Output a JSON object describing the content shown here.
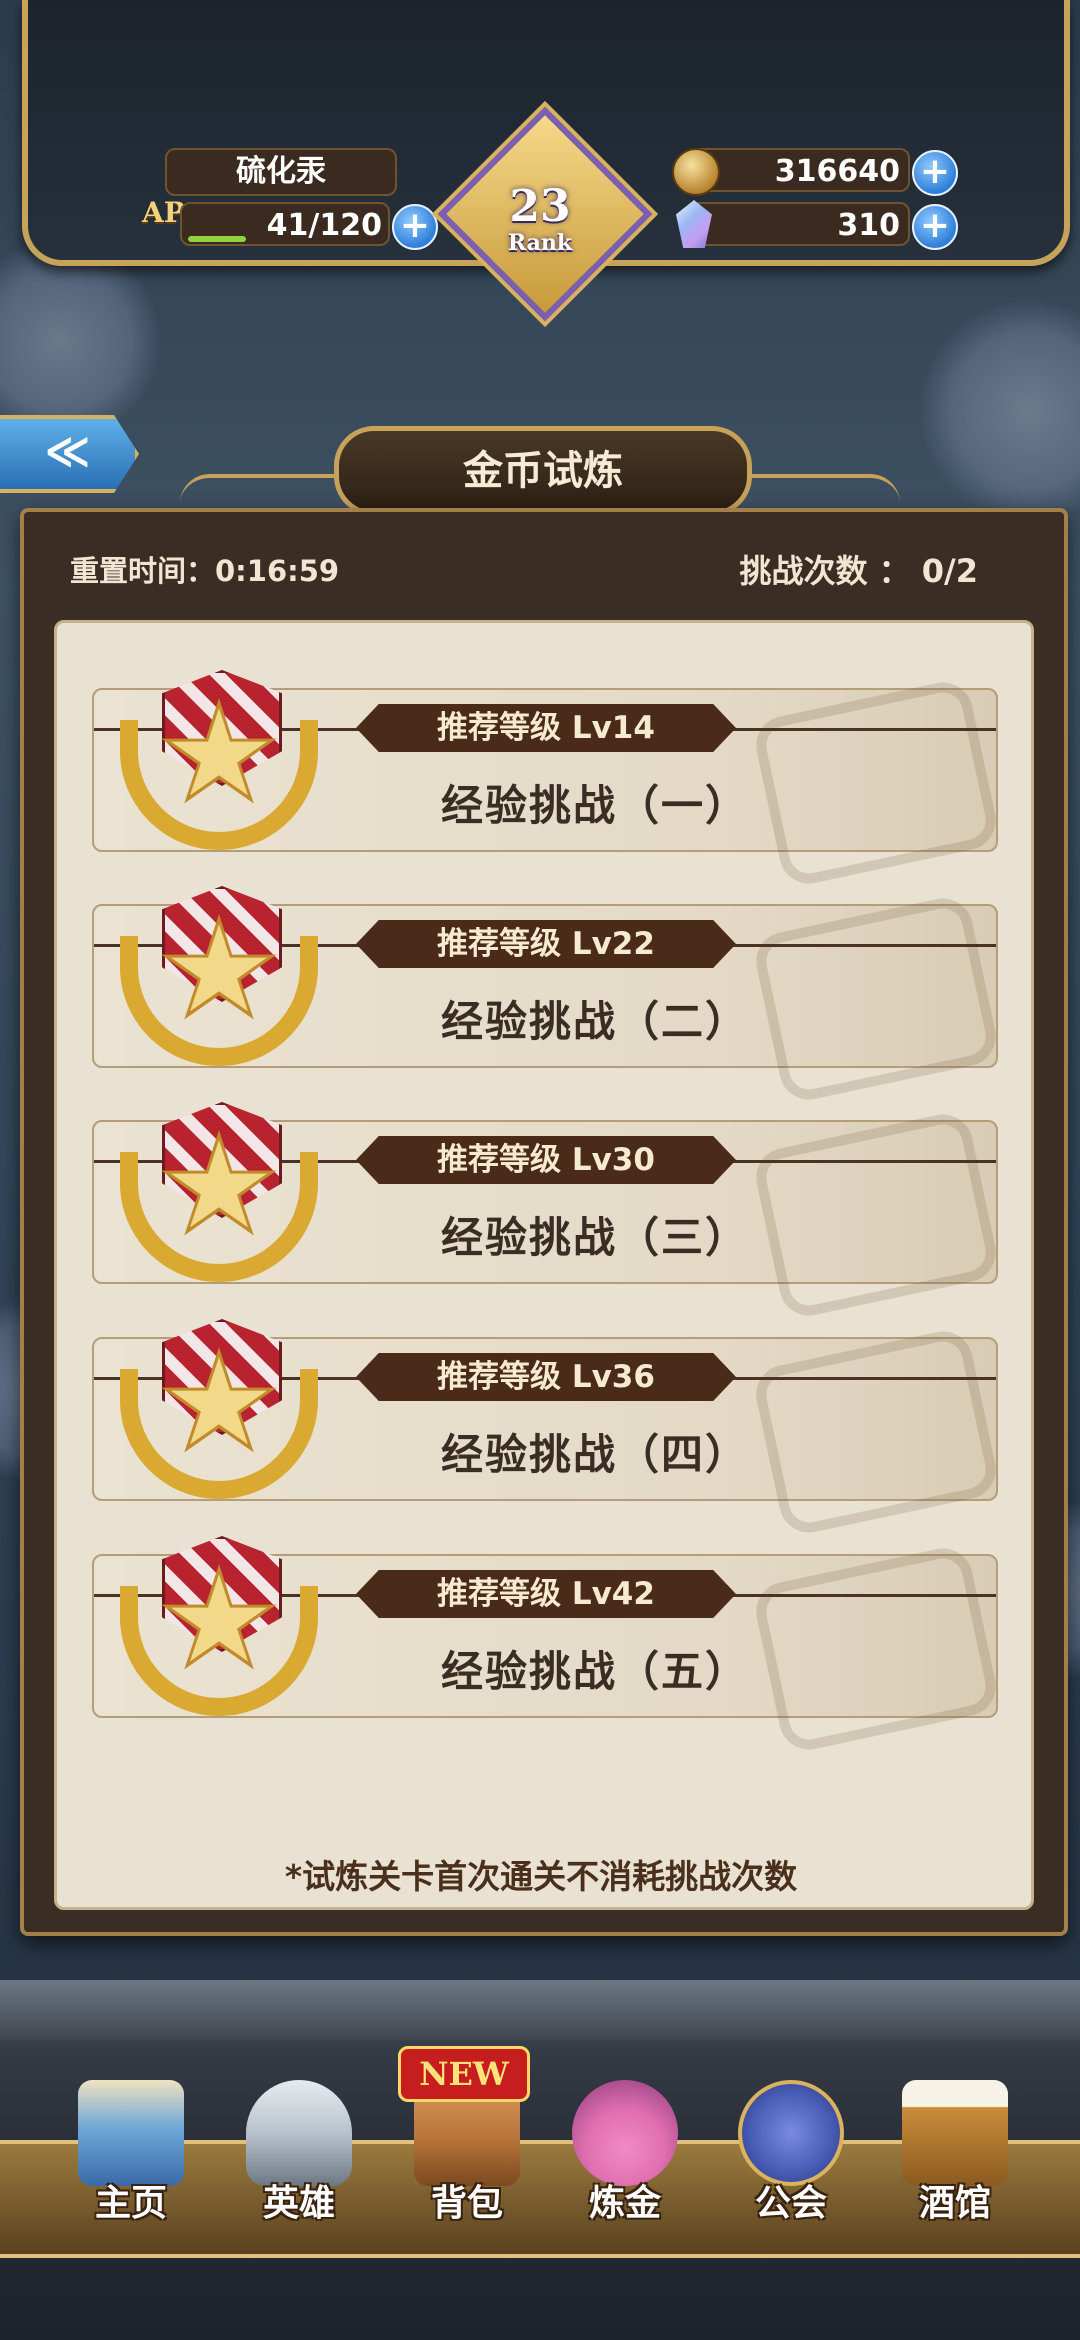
{
  "hud": {
    "player_name": "硫化汞",
    "ap_label": "AP",
    "ap_value": "41/120",
    "gold": "316640",
    "gems": "310",
    "rank_number": "23",
    "rank_label": "Rank",
    "plus_symbol": "+"
  },
  "back_button": {
    "icon": "double-chevron-left-icon",
    "symbol": "≪"
  },
  "title": "金币试炼",
  "reset_label": "重置时间：0:16:59",
  "challenge_count": "挑战次数 ： 0/2",
  "challenges": [
    {
      "level": "推荐等级  Lv14",
      "name": "经验挑战（一）"
    },
    {
      "level": "推荐等级  Lv22",
      "name": "经验挑战（二）"
    },
    {
      "level": "推荐等级  Lv30",
      "name": "经验挑战（三）"
    },
    {
      "level": "推荐等级  Lv36",
      "name": "经验挑战（四）"
    },
    {
      "level": "推荐等级  Lv42",
      "name": "经验挑战（五）"
    }
  ],
  "note": "*试炼关卡首次通关不消耗挑战次数",
  "nav": {
    "new_badge": "NEW",
    "items": [
      {
        "label": "主页",
        "icon": "castle-icon",
        "color": "#6fa8d8"
      },
      {
        "label": "英雄",
        "icon": "helmet-icon",
        "color": "#b9c2cc"
      },
      {
        "label": "背包",
        "icon": "backpack-icon",
        "color": "#b8743a"
      },
      {
        "label": "炼金",
        "icon": "potion-icon",
        "color": "#e06fb0"
      },
      {
        "label": "公会",
        "icon": "guild-shield-icon",
        "color": "#4a5fb8"
      },
      {
        "label": "酒馆",
        "icon": "beer-mug-icon",
        "color": "#c98c3a"
      }
    ]
  }
}
